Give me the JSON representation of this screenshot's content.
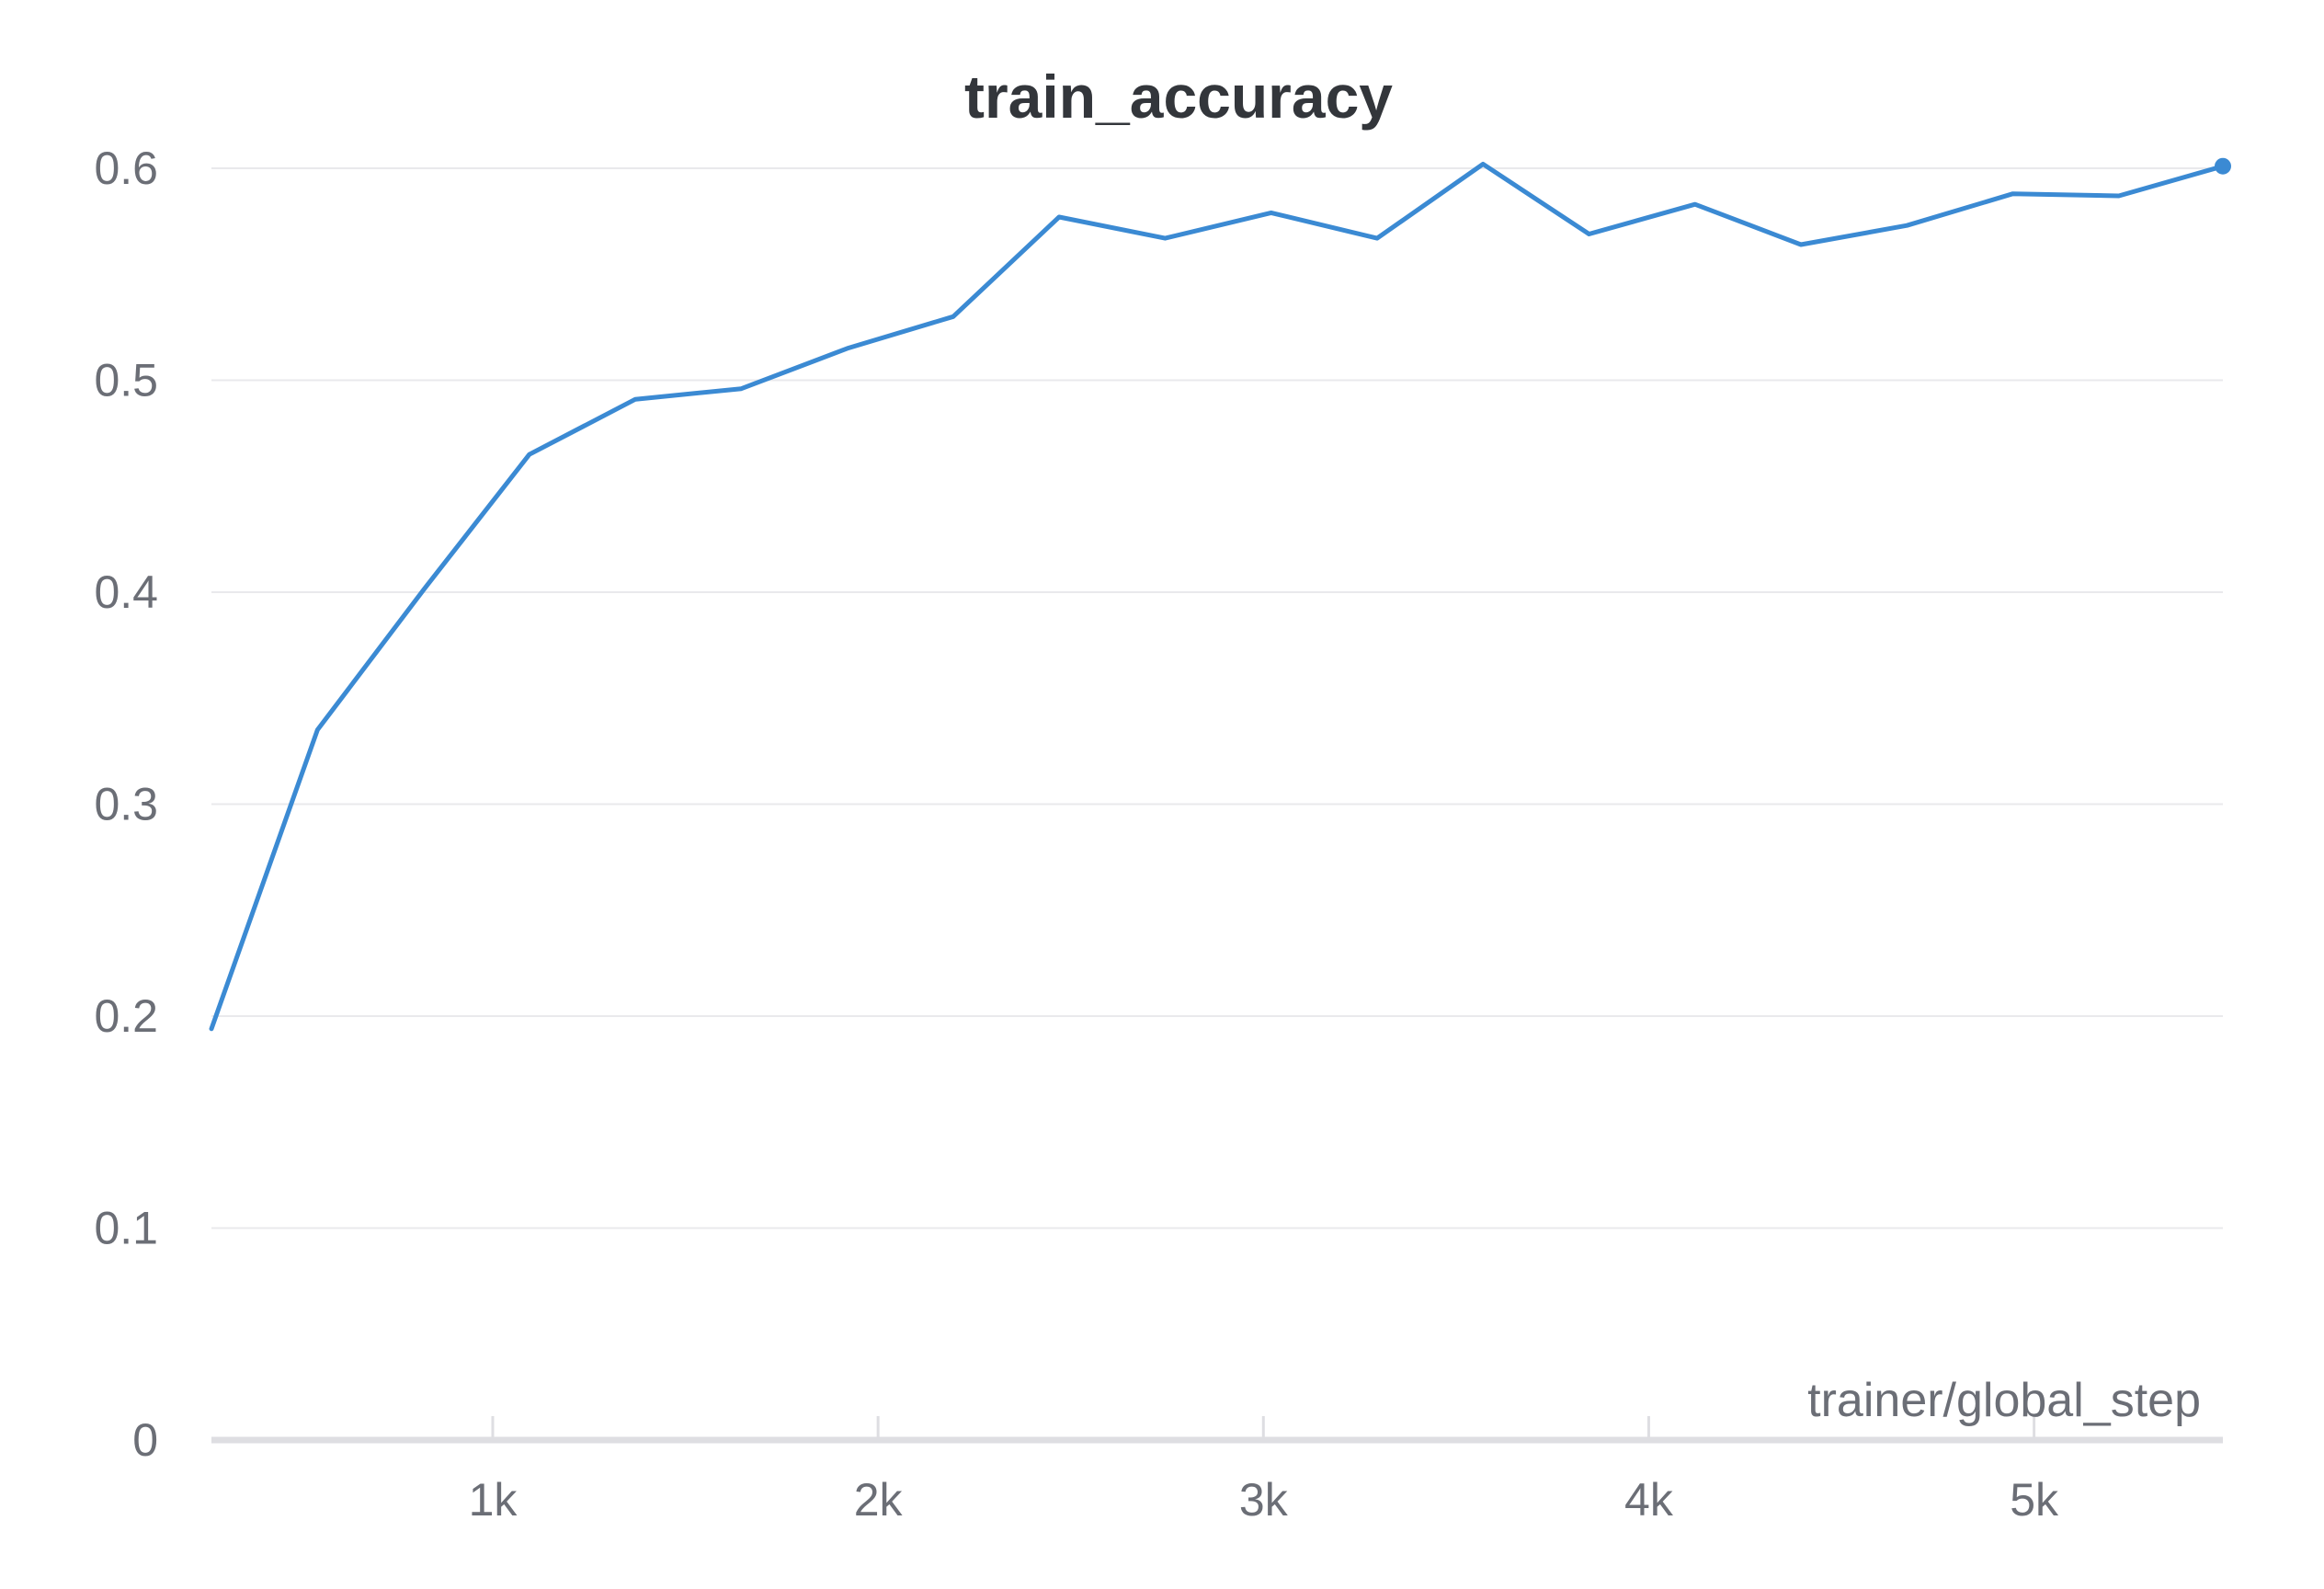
{
  "chart_data": {
    "type": "line",
    "title": "train_accuracy",
    "xlabel": "trainer/global_step",
    "ylabel": "",
    "xlim": [
      270,
      5490
    ],
    "ylim": [
      0,
      0.6
    ],
    "x_ticks": [
      1000,
      2000,
      3000,
      4000,
      5000
    ],
    "x_tick_labels": [
      "1k",
      "2k",
      "3k",
      "4k",
      "5k"
    ],
    "y_ticks": [
      0,
      0.1,
      0.2,
      0.3,
      0.4,
      0.5,
      0.6
    ],
    "y_tick_labels": [
      "0",
      "0.1",
      "0.2",
      "0.3",
      "0.4",
      "0.5",
      "0.6"
    ],
    "grid": true,
    "legend": "none",
    "colors": {
      "series": "#3b8ad3",
      "title": "#33363b",
      "text": "#6b6e76",
      "grid": "#e9e9ec",
      "axis": "#dedee2"
    },
    "series": [
      {
        "x": [
          270,
          545,
          820,
          1095,
          1370,
          1645,
          1920,
          2195,
          2470,
          2745,
          3020,
          3295,
          3570,
          3845,
          4120,
          4395,
          4670,
          4945,
          5220,
          5490
        ],
        "y": [
          0.194,
          0.335,
          0.401,
          0.465,
          0.491,
          0.496,
          0.515,
          0.53,
          0.577,
          0.567,
          0.579,
          0.567,
          0.602,
          0.569,
          0.583,
          0.564,
          0.573,
          0.588,
          0.587,
          0.601
        ],
        "last_point_marker": true
      }
    ]
  }
}
